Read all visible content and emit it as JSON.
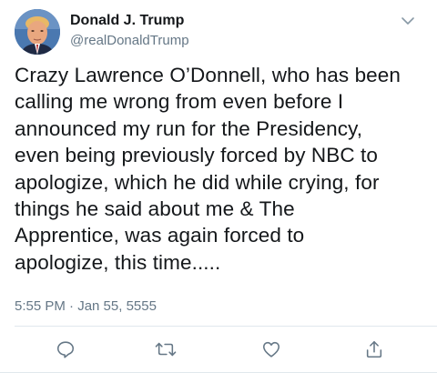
{
  "tweet": {
    "author": {
      "display_name": "Donald J. Trump",
      "handle": "@realDonaldTrump",
      "avatar_icon": "profile-photo"
    },
    "menu_icon": "chevron-down-icon",
    "text": "Crazy Lawrence O’Donnell, who has been\ncalling me wrong from even before I\nannounced my run for the Presidency,\neven being previously forced by NBC to\napologize, which he did while crying, for\nthings he said about me & The\nApprentice, was again forced to\napologize, this time.....",
    "timestamp": "5:55 PM · Jan 55, 5555"
  },
  "actions": [
    {
      "icon": "reply-icon"
    },
    {
      "icon": "retweet-icon"
    },
    {
      "icon": "like-icon"
    },
    {
      "icon": "share-icon"
    }
  ],
  "colors": {
    "text": "#14171a",
    "secondary": "#657786",
    "divider": "#e1e8ed"
  }
}
